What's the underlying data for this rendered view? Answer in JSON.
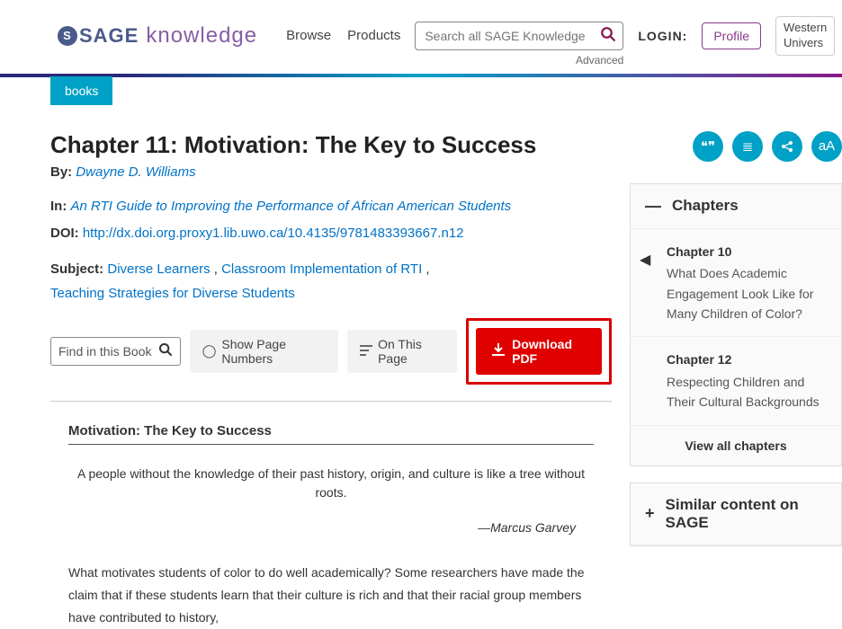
{
  "header": {
    "logo_brand": "SAGE",
    "logo_product": "knowledge",
    "nav": {
      "browse": "Browse",
      "products": "Products"
    },
    "search_placeholder": "Search all SAGE Knowledge",
    "advanced": "Advanced",
    "login_label": "LOGIN:",
    "profile": "Profile",
    "university_line1": "Western",
    "university_line2": "Univers"
  },
  "tag": "books",
  "title": "Chapter 11: Motivation: The Key to Success",
  "by_label": "By:",
  "author": "Dwayne D. Williams",
  "in_label": "In:",
  "in_title": "An RTI Guide to Improving the Performance of African American Students",
  "doi_label": "DOI:",
  "doi_link": "http://dx.doi.org.proxy1.lib.uwo.ca/10.4135/9781483393667.n12",
  "subject_label": "Subject:",
  "subjects": {
    "a": "Diverse Learners",
    "b": "Classroom Implementation of RTI",
    "c": "Teaching Strategies for Diverse Students"
  },
  "tools": {
    "find_placeholder": "Find in this Book",
    "show_pages": "Show Page Numbers",
    "on_page": "On This Page",
    "download": "Download PDF"
  },
  "article": {
    "heading": "Motivation: The Key to Success",
    "quote": "A people without the knowledge of their past history, origin, and culture is like a tree without roots.",
    "attribution": "—Marcus Garvey",
    "paragraph": "What motivates students of color to do well academically? Some researchers have made the claim that if these students learn that their culture is rich and that their racial group members have contributed to history,"
  },
  "side": {
    "chapters_title": "Chapters",
    "prev": {
      "label": "Chapter 10",
      "title": "What Does Academic Engagement Look Like for Many Children of Color?"
    },
    "next": {
      "label": "Chapter 12",
      "title": "Respecting Children and Their Cultural Backgrounds"
    },
    "view_all": "View all chapters",
    "similar_title": "Similar content on SAGE"
  },
  "icons": {
    "cite": "❝❞",
    "list": "≣",
    "share": "➦",
    "font": "aA"
  }
}
